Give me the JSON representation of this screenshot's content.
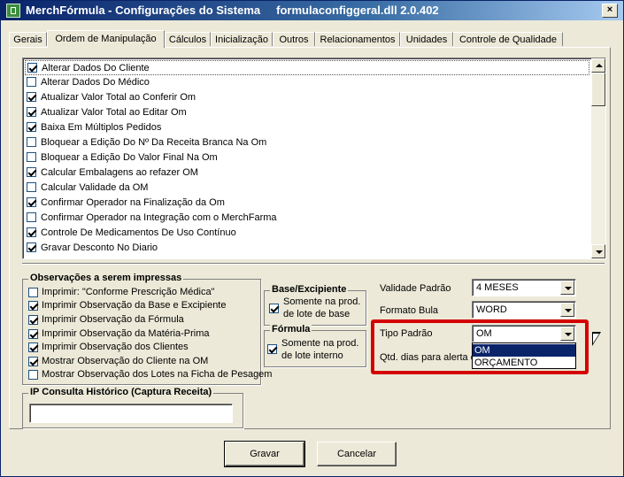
{
  "window": {
    "title": "MerchFórmula - Configurações do Sistema     formulaconfiggeral.dll 2.0.402",
    "close_label": "×"
  },
  "tabs": [
    {
      "label": "Gerais",
      "active": false
    },
    {
      "label": "Ordem de Manipulação",
      "active": true
    },
    {
      "label": "Cálculos",
      "active": false
    },
    {
      "label": "Inicialização",
      "active": false
    },
    {
      "label": "Outros",
      "active": false
    },
    {
      "label": "Relacionamentos",
      "active": false
    },
    {
      "label": "Unidades",
      "active": false
    },
    {
      "label": "Controle de Qualidade",
      "active": false
    }
  ],
  "options": [
    {
      "label": "Alterar Dados Do Cliente",
      "checked": true
    },
    {
      "label": "Alterar Dados Do Médico",
      "checked": false
    },
    {
      "label": "Atualizar Valor Total ao Conferir Om",
      "checked": true
    },
    {
      "label": "Atualizar Valor Total ao Editar Om",
      "checked": true
    },
    {
      "label": "Baixa Em Múltiplos Pedidos",
      "checked": true
    },
    {
      "label": "Bloquear a Edição Do Nº Da Receita Branca Na Om",
      "checked": false
    },
    {
      "label": "Bloquear a Edição Do Valor Final Na Om",
      "checked": false
    },
    {
      "label": "Calcular Embalagens ao refazer OM",
      "checked": true
    },
    {
      "label": "Calcular Validade da OM",
      "checked": false
    },
    {
      "label": "Confirmar Operador na Finalização da Om",
      "checked": true
    },
    {
      "label": "Confirmar Operador na Integração com o MerchFarma",
      "checked": false
    },
    {
      "label": "Controle De Medicamentos De Uso Contínuo",
      "checked": true
    },
    {
      "label": "Gravar Desconto No Diario",
      "checked": true
    }
  ],
  "observacoes": {
    "legend": "Observações a serem impressas",
    "items": [
      {
        "label": "Imprimir: \"Conforme Prescrição Médica\"",
        "checked": false
      },
      {
        "label": "Imprimir Observação da Base e Excipiente",
        "checked": true
      },
      {
        "label": "Imprimir Observação da Fórmula",
        "checked": true
      },
      {
        "label": "Imprimir Observação da Matéria-Prima",
        "checked": true
      },
      {
        "label": "Imprimir Observação dos Clientes",
        "checked": true
      },
      {
        "label": "Mostrar Observação do Cliente na OM",
        "checked": true
      },
      {
        "label": "Mostrar Observação dos Lotes na Ficha de Pesagem",
        "checked": false
      }
    ]
  },
  "base_excipiente": {
    "legend": "Base/Excipiente",
    "line1": "Somente na prod.",
    "line2": "de lote de base",
    "checked": true
  },
  "formula": {
    "legend": "Fórmula",
    "line1": "Somente na prod.",
    "line2": "de lote interno",
    "checked": true
  },
  "fields": {
    "validade_label": "Validade Padrão",
    "validade_value": "4 MESES",
    "formato_label": "Formato Bula",
    "formato_value": "WORD",
    "tipo_label": "Tipo Padrão",
    "tipo_value": "OM",
    "qtd_label": "Qtd. dias para alerta d",
    "tipo_options": [
      "OM",
      "ORÇAMENTO"
    ]
  },
  "ip_consulta": {
    "legend": "IP Consulta Histórico (Captura Receita)",
    "value": ""
  },
  "buttons": {
    "gravar": "Gravar",
    "cancelar": "Cancelar"
  }
}
